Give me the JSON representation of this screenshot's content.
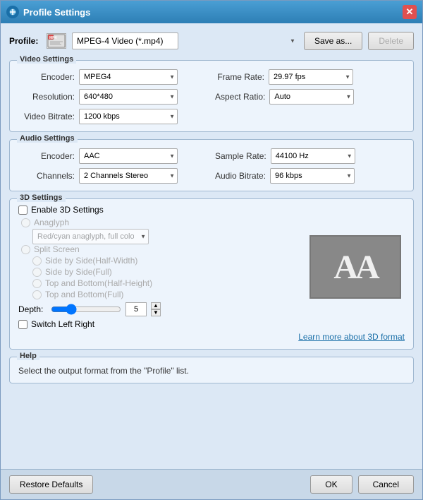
{
  "titleBar": {
    "title": "Profile Settings",
    "closeLabel": "✕"
  },
  "profileRow": {
    "label": "Profile:",
    "iconLabel": "MP4",
    "selectedProfile": "MPEG-4 Video (*.mp4)",
    "saveAsLabel": "Save as...",
    "deleteLabel": "Delete"
  },
  "videoSettings": {
    "sectionTitle": "Video Settings",
    "encoderLabel": "Encoder:",
    "encoderValue": "MPEG4",
    "resolutionLabel": "Resolution:",
    "resolutionValue": "640*480",
    "videoBitrateLabel": "Video Bitrate:",
    "videoBitrateValue": "1200 kbps",
    "frameRateLabel": "Frame Rate:",
    "frameRateValue": "29.97 fps",
    "aspectRatioLabel": "Aspect Ratio:",
    "aspectRatioValue": "Auto"
  },
  "audioSettings": {
    "sectionTitle": "Audio Settings",
    "encoderLabel": "Encoder:",
    "encoderValue": "AAC",
    "channelsLabel": "Channels:",
    "channelsValue": "2 Channels Stereo",
    "sampleRateLabel": "Sample Rate:",
    "sampleRateValue": "44100 Hz",
    "audioBitrateLabel": "Audio Bitrate:",
    "audioBitrateValue": "96 kbps"
  },
  "threeDSettings": {
    "sectionTitle": "3D Settings",
    "enableLabel": "Enable 3D Settings",
    "anaglyphLabel": "Anaglyph",
    "anaglyphOptionLabel": "Red/cyan anaglyph, full color",
    "splitScreenLabel": "Split Screen",
    "options": [
      "Side by Side(Half-Width)",
      "Side by Side(Full)",
      "Top and Bottom(Half-Height)",
      "Top and Bottom(Full)"
    ],
    "depthLabel": "Depth:",
    "depthValue": "5",
    "switchLeftRightLabel": "Switch Left Right",
    "learnMoreLabel": "Learn more about 3D format",
    "previewText": "AA"
  },
  "help": {
    "sectionTitle": "Help",
    "helpText": "Select the output format from the \"Profile\" list."
  },
  "footer": {
    "restoreDefaultsLabel": "Restore Defaults",
    "okLabel": "OK",
    "cancelLabel": "Cancel"
  }
}
